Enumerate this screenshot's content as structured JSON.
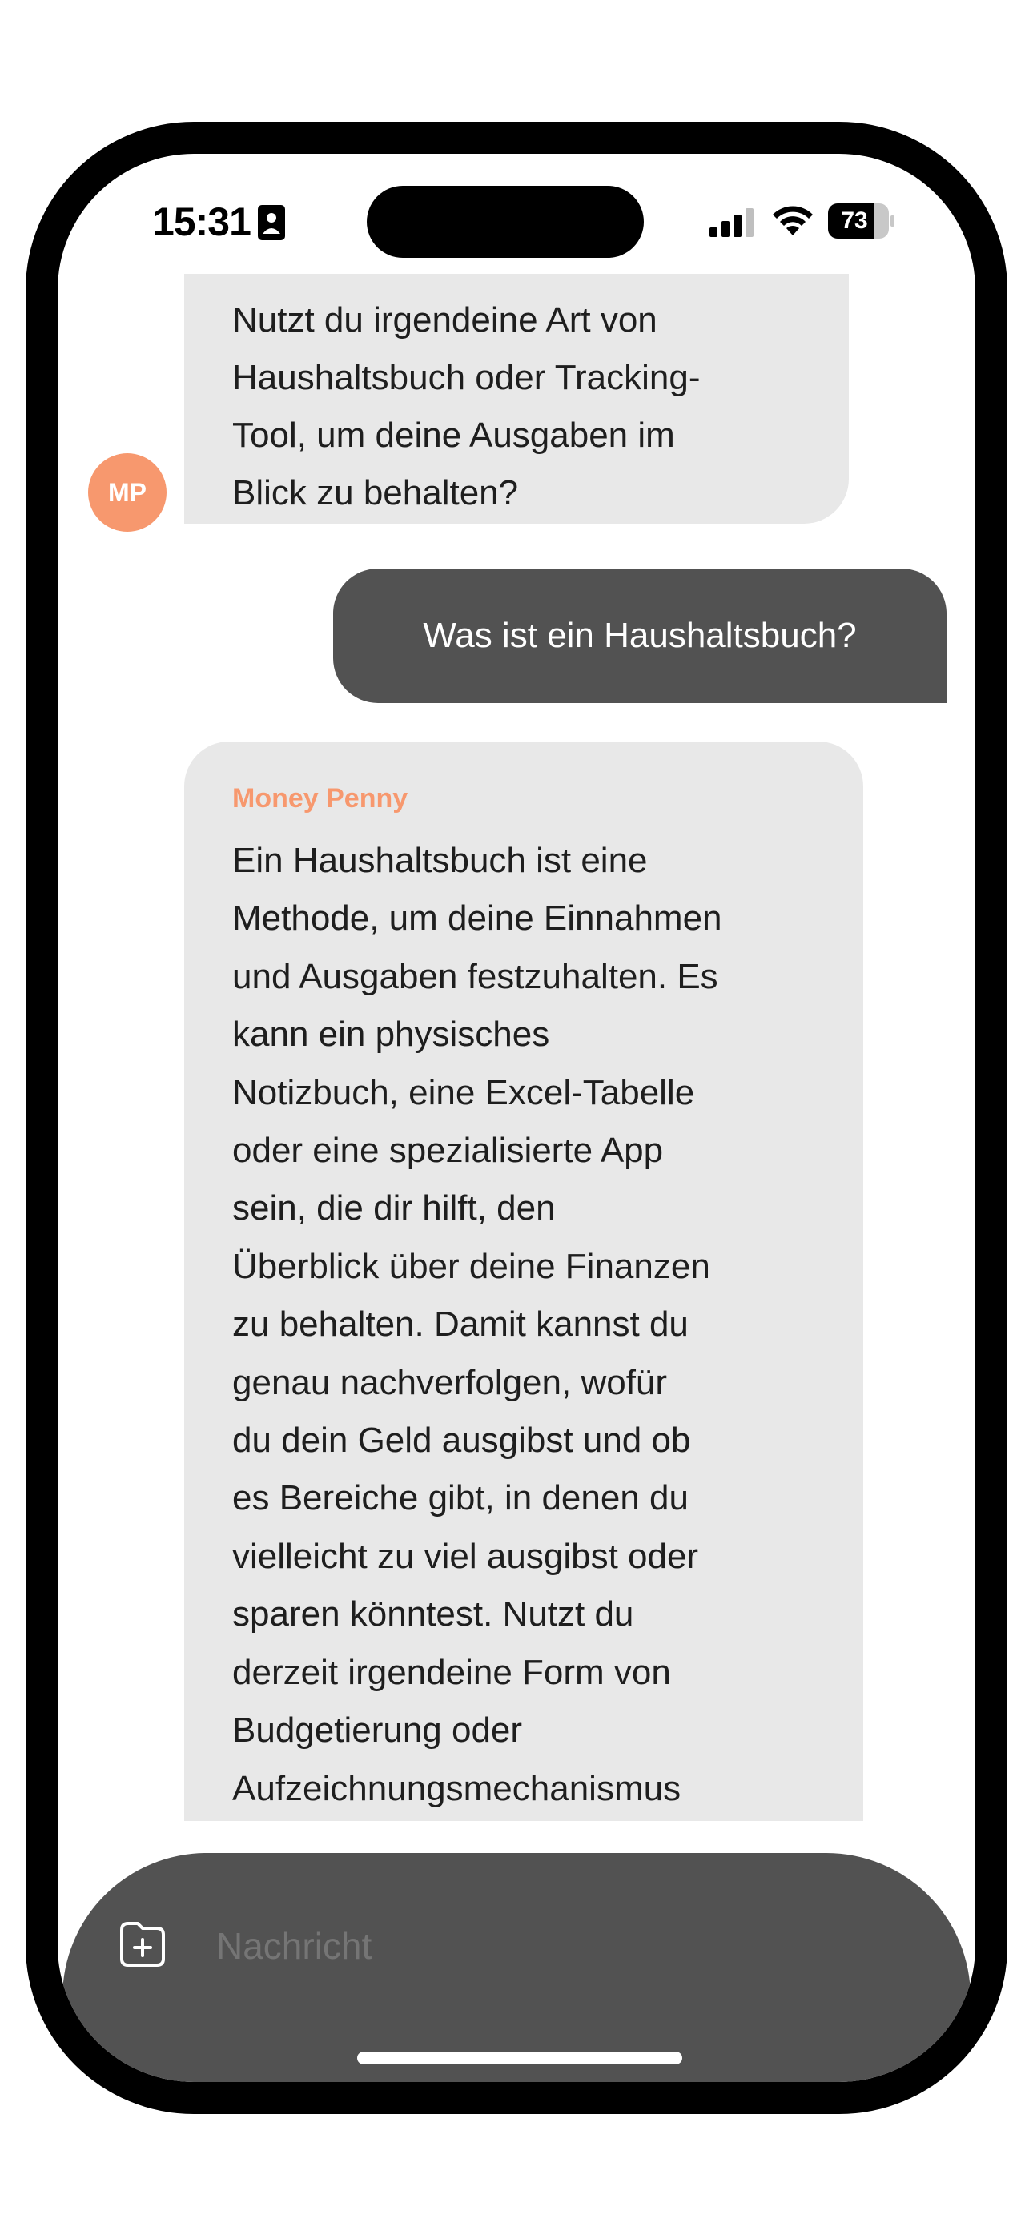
{
  "status_bar": {
    "time": "15:31",
    "battery": "73"
  },
  "chat": {
    "previous_message": "Nutzt du irgendeine Art von\nHaushaltsbuch oder Tracking-\nTool, um deine Ausgaben im\nBlick zu behalten?",
    "avatar_initials": "MP",
    "user_message": "Was ist ein Haushaltsbuch?",
    "bot_sender": "Money Penny",
    "bot_message": "Ein Haushaltsbuch ist eine\nMethode, um deine Einnahmen\nund Ausgaben festzuhalten. Es\nkann ein physisches\nNotizbuch, eine Excel-Tabelle\noder eine spezialisierte App\nsein, die dir hilft, den\nÜberblick über deine Finanzen\nzu behalten. Damit kannst du\ngenau nachverfolgen, wofür\ndu dein Geld ausgibst und ob\nes Bereiche gibt, in denen du\nvielleicht zu viel ausgibst oder\nsparen könntest. Nutzt du\nderzeit irgendeine Form von\nBudgetierung oder\nAufzeichnungsmechanismus"
  },
  "composer": {
    "placeholder": "Nachricht"
  },
  "colors": {
    "accent": "#f7986e",
    "user_bubble": "#525252",
    "bot_bubble": "#e8e8e8"
  }
}
